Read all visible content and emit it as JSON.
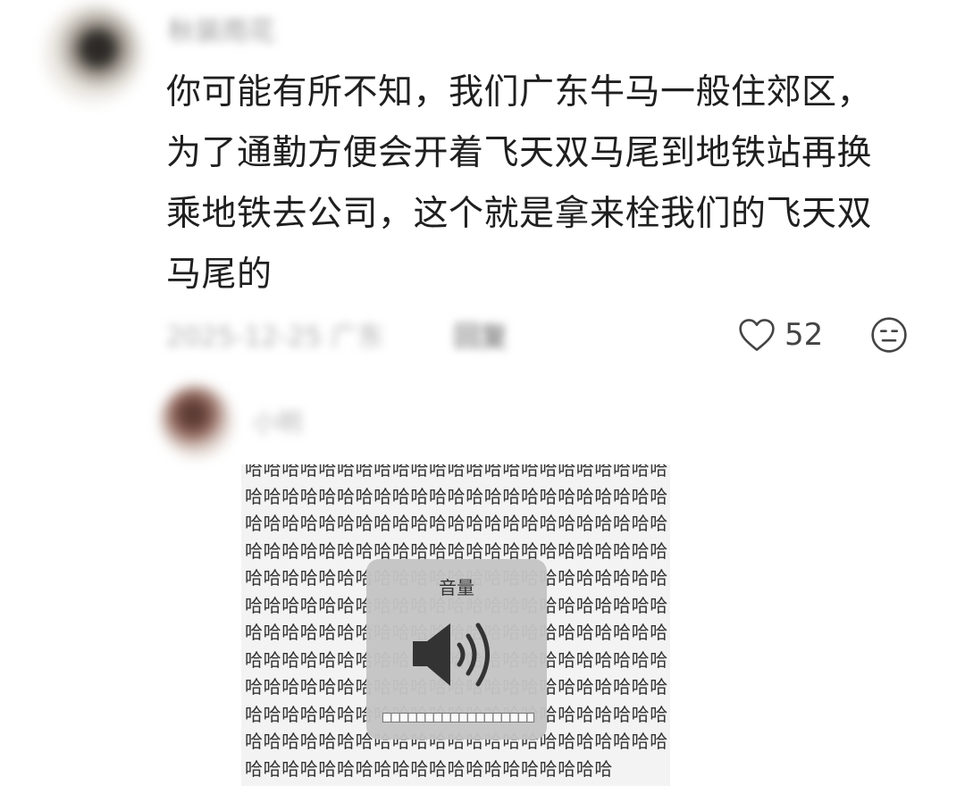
{
  "comment": {
    "username": "秋装雨花",
    "lines": [
      "你可能有所不知，我们广东牛马一般住郊区，",
      "为了通勤方便会开着飞天双马尾到地铁站再换",
      "乘地铁去公司，这个就是拿来栓我们的飞天双",
      "马尾的"
    ],
    "meta_date": "2025-12-25 广东",
    "reply_label": "回复",
    "like_count": "52",
    "icons": {
      "like": "heart-outline-icon",
      "dislike": "meh-face-icon"
    }
  },
  "reply": {
    "username": "小明",
    "sticker": {
      "pattern_char": "哈",
      "volume_title": "音量",
      "volume_icon": "speaker-icon",
      "volume_level": 1.0
    }
  }
}
